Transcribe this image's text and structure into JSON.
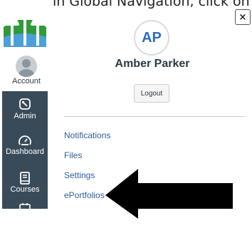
{
  "caption": "in Global Navigation, click on Settings",
  "close_label": "×",
  "nav": {
    "account_label": "Account",
    "items": [
      {
        "label": "Admin",
        "icon": "shield-icon"
      },
      {
        "label": "Dashboard",
        "icon": "gauge-icon"
      },
      {
        "label": "Courses",
        "icon": "book-icon"
      }
    ]
  },
  "profile": {
    "initials": "AP",
    "name": "Amber Parker",
    "logout_label": "Logout"
  },
  "links": [
    {
      "label": "Notifications"
    },
    {
      "label": "Files"
    },
    {
      "label": "Settings"
    },
    {
      "label": "ePortfolios"
    }
  ],
  "colors": {
    "nav_dark": "#394b58",
    "link": "#2b5f9e",
    "initials": "#2b6cc4"
  }
}
